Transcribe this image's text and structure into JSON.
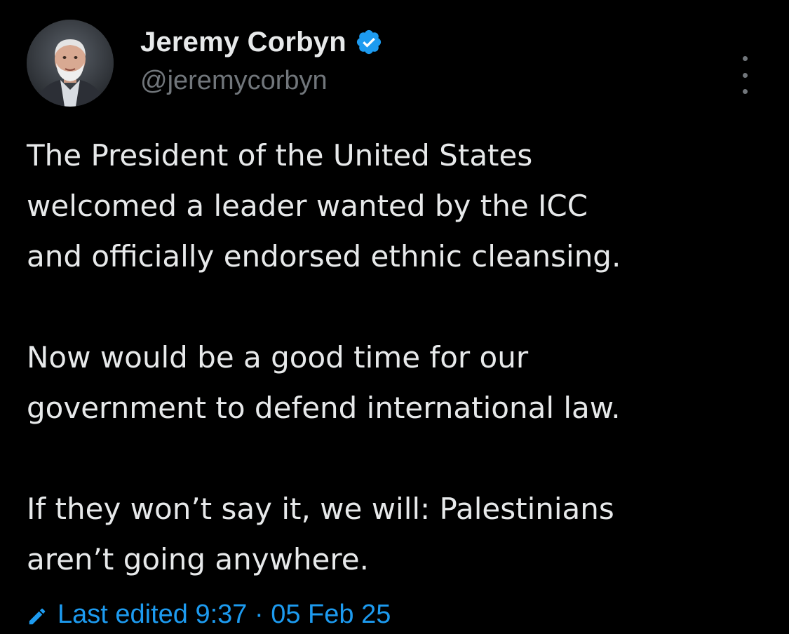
{
  "author": {
    "display_name": "Jeremy Corbyn",
    "handle": "@jeremycorbyn",
    "verified": true
  },
  "icons": {
    "verified": "verified-badge-icon",
    "more": "more-options-icon",
    "edit": "pencil-icon"
  },
  "colors": {
    "background": "#000000",
    "text": "#e7e9ea",
    "secondary_text": "#71767b",
    "accent": "#1d9bf0"
  },
  "tweet": {
    "paragraphs": [
      {
        "lines": [
          "The President of the United States",
          "welcomed a leader wanted by the ICC",
          "and officially endorsed ethnic cleansing."
        ]
      },
      {
        "lines": [
          "Now would be a good time for our",
          "government to defend international law."
        ]
      },
      {
        "lines": [
          "If they won’t say it, we will: Palestinians",
          "aren’t going anywhere."
        ]
      }
    ],
    "edited_label": "Last edited 9:37 · 05 Feb 25"
  }
}
